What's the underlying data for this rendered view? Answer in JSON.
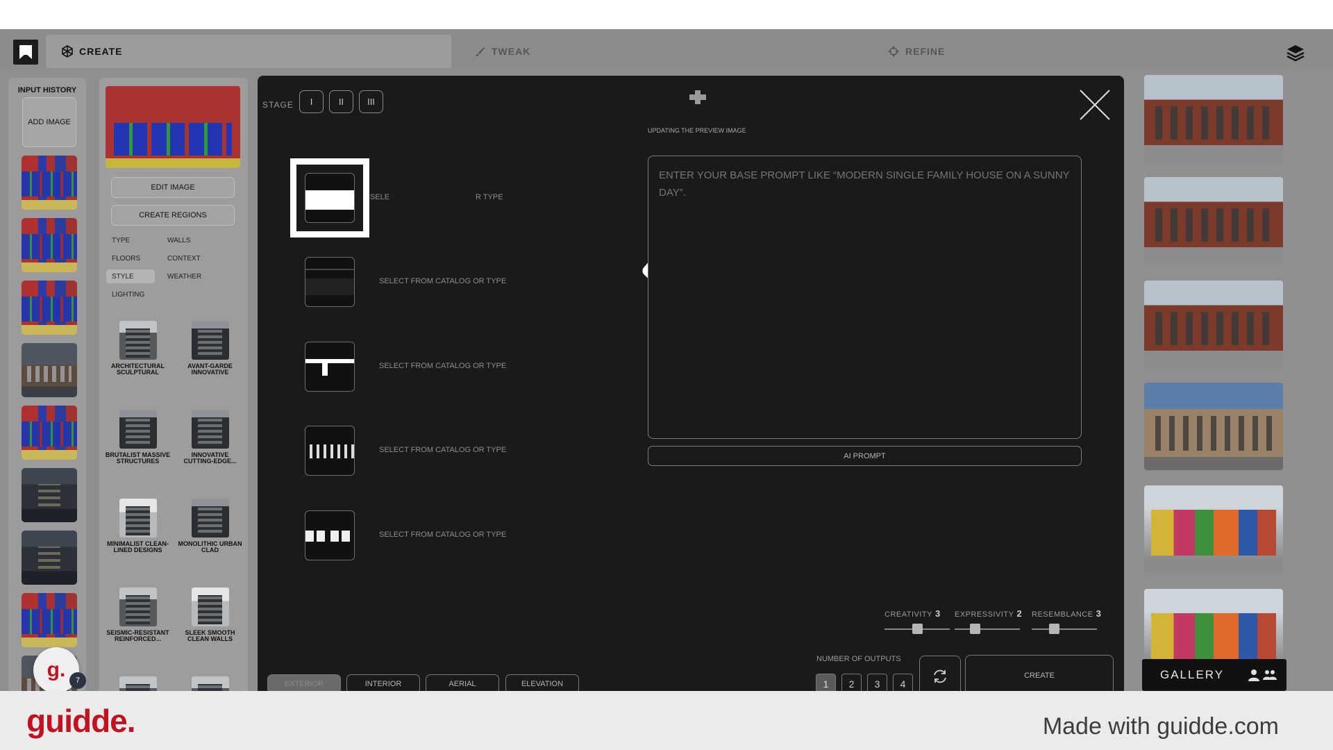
{
  "tabs": {
    "create": "CREATE",
    "tweak": "TWEAK",
    "refine": "REFINE"
  },
  "history": {
    "title": "INPUT HISTORY",
    "add_image": "ADD IMAGE"
  },
  "style_panel": {
    "edit_image": "EDIT IMAGE",
    "create_regions": "CREATE REGIONS",
    "chips": [
      "TYPE",
      "WALLS",
      "FLOORS",
      "CONTEXT",
      "STYLE",
      "WEATHER",
      "LIGHTING"
    ],
    "selected_chip": "STYLE",
    "styles": [
      {
        "label": "ARCHITECTURAL SCULPTURAL"
      },
      {
        "label": "AVANT-GARDE INNOVATIVE"
      },
      {
        "label": "BRUTALIST MASSIVE STRUCTURES"
      },
      {
        "label": "INNOVATIVE CUTTING-EDGE..."
      },
      {
        "label": "MINIMALIST CLEAN-LINED DESIGNS"
      },
      {
        "label": "MONOLITHIC URBAN CLAD"
      },
      {
        "label": "SEISMIC-RESISTANT REINFORCED..."
      },
      {
        "label": "SLEEK SMOOTH CLEAN WALLS"
      }
    ]
  },
  "modal": {
    "stage_label": "STAGE",
    "stages": [
      "I",
      "II",
      "III"
    ],
    "updating": "UPDATING THE PREVIEW IMAGE",
    "option_text": "SELECT FROM CATALOG OR TYPE",
    "option_text_partial_left": "SELE",
    "option_text_partial_right": "R TYPE",
    "prompt_placeholder": "ENTER YOUR BASE PROMPT LIKE “MODERN SINGLE FAMILY HOUSE ON A SUNNY DAY”.",
    "ai_prompt": "AI PROMPT",
    "sliders": [
      {
        "label": "CREATIVITY",
        "value": 3
      },
      {
        "label": "EXPRESSIVITY",
        "value": 2
      },
      {
        "label": "RESEMBLANCE",
        "value": 3
      }
    ],
    "outputs_label": "NUMBER OF OUTPUTS",
    "outputs": [
      "1",
      "2",
      "3",
      "4"
    ],
    "selected_output": "1",
    "create": "CREATE",
    "modes": [
      "EXTERIOR",
      "INTERIOR",
      "AERIAL",
      "ELEVATION"
    ],
    "selected_mode": "EXTERIOR"
  },
  "gallery": {
    "label": "GALLERY"
  },
  "avatar": {
    "letter": "g.",
    "badge": "7"
  },
  "footer": {
    "brand": "guidde.",
    "made_with": "Made with guidde.com"
  },
  "colors": {
    "brand_red": "#c1121f",
    "modal_bg": "#1a1a1a",
    "backdrop": "#8f8f8f"
  }
}
